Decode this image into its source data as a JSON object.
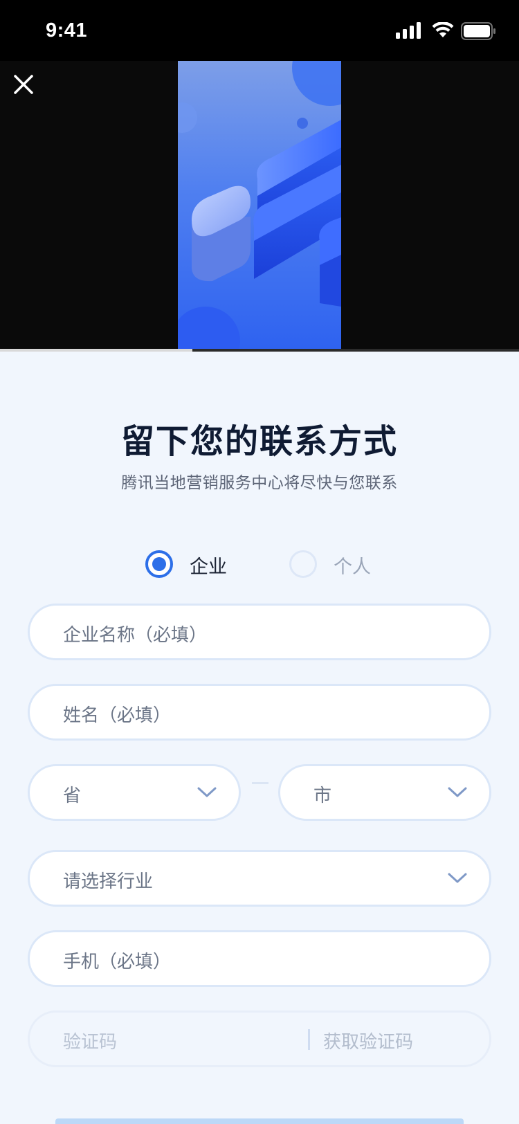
{
  "status_bar": {
    "time": "9:41"
  },
  "video": {
    "progress_percent": 37
  },
  "form": {
    "title": "留下您的联系方式",
    "subtitle": "腾讯当地营销服务中心将尽快与您联系",
    "type_options": [
      {
        "label": "企业",
        "selected": true
      },
      {
        "label": "个人",
        "selected": false
      }
    ],
    "company_name_placeholder": "企业名称（必填）",
    "name_placeholder": "姓名（必填）",
    "province_placeholder": "省",
    "city_placeholder": "市",
    "industry_placeholder": "请选择行业",
    "phone_placeholder": "手机（必填）",
    "code_placeholder": "验证码",
    "get_code_label": "获取验证码"
  },
  "colors": {
    "accent": "#2d6fe8",
    "background": "#f1f6fd",
    "field_border": "#dbe7f8"
  },
  "icons": [
    "signal-icon",
    "wifi-icon",
    "battery-icon",
    "close-icon",
    "chevron-down-icon"
  ]
}
